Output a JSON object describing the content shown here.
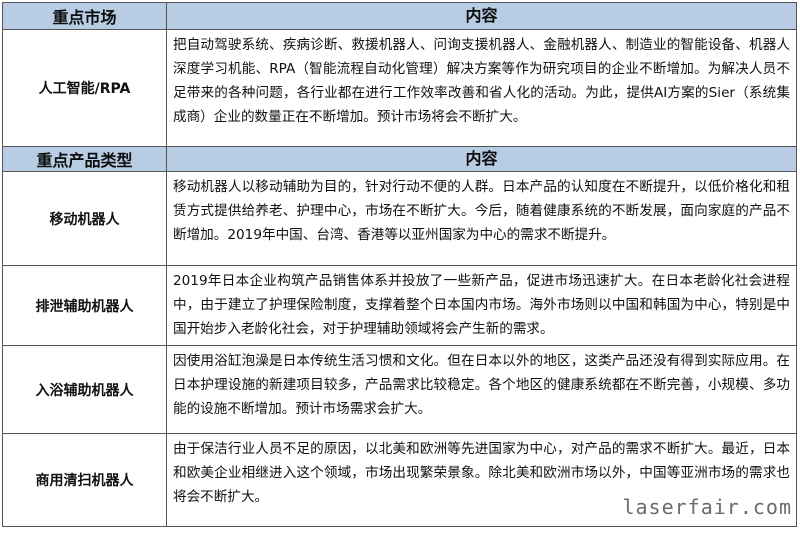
{
  "header1": {
    "col1": "重点市场",
    "col2": "内容"
  },
  "header2": {
    "col1": "重点产品类型",
    "col2": "内容"
  },
  "rows": [
    {
      "label": "人工智能/RPA",
      "content": "把自动驾驶系统、疾病诊断、救援机器人、问询支援机器人、金融机器人、制造业的智能设备、机器人深度学习机能、RPA（智能流程自动化管理）解决方案等作为研究项目的企业不断增加。为解决人员不足带来的各种问题，各行业都在进行工作效率改善和省人化的活动。为此，提供AI方案的Sier（系统集成商）企业的数量正在不断增加。预计市场将会不断扩大。"
    },
    {
      "label": "移动机器人",
      "content": "移动机器人以移动辅助为目的，针对行动不便的人群。日本产品的认知度在不断提升，以低价格化和租赁方式提供给养老、护理中心，市场在不断扩大。今后，随着健康系统的不断发展，面向家庭的产品不断增加。2019年中国、台湾、香港等以亚州国家为中心的需求不断提升。"
    },
    {
      "label": "排泄辅助机器人",
      "content": "2019年日本企业构筑产品销售体系并投放了一些新产品，促进市场迅速扩大。在日本老龄化社会进程中，由于建立了护理保险制度，支撑着整个日本国内市场。海外市场则以中国和韩国为中心，特别是中国开始步入老龄化社会，对于护理辅助领域将会产生新的需求。"
    },
    {
      "label": "入浴辅助机器人",
      "content": "因使用浴缸泡澡是日本传统生活习惯和文化。但在日本以外的地区，这类产品还没有得到实际应用。在日本护理设施的新建项目较多，产品需求比较稳定。各个地区的健康系统都在不断完善，小规模、多功能的设施不断增加。预计市场需求会扩大。"
    },
    {
      "label": "商用清扫机器人",
      "content": "由于保洁行业人员不足的原因，以北美和欧洲等先进国家为中心，对产品的需求不断扩大。最近，日本和欧美企业相继进入这个领域，市场出现繁荣景象。除北美和欧洲市场以外，中国等亚洲市场的需求也将会不断扩大。"
    }
  ],
  "watermark": "laserfair.com"
}
